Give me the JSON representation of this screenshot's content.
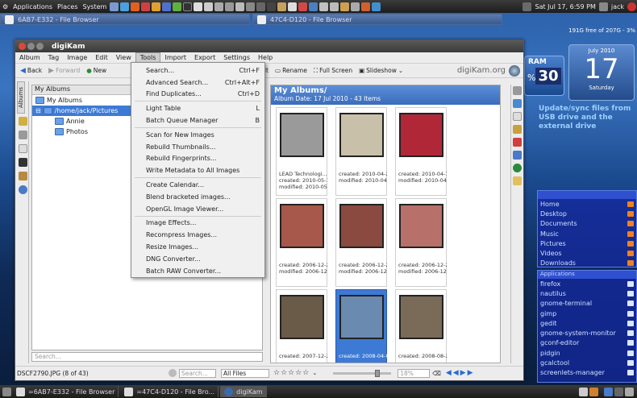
{
  "topbar": {
    "menus": [
      "Applications",
      "Places",
      "System"
    ],
    "datetime": "Sat Jul 17,  6:59 PM",
    "user": "jack"
  },
  "windowlist": [
    "6AB7-E332 - File Browser",
    "47C4-D120 - File Browser"
  ],
  "disk": "191G free of 207G - 3%",
  "widgets": {
    "ram_label": "RAM",
    "ram_percent": "30",
    "ram_symbol": "%",
    "cal_month": "July 2010",
    "cal_day": "17",
    "cal_weekday": "Saturday",
    "note": "Update/sync files from USB drive and the external drive",
    "places": [
      "Home",
      "Desktop",
      "Documents",
      "Music",
      "Pictures",
      "Videos",
      "Downloads"
    ],
    "apps_header": "Applications",
    "apps": [
      "firefox",
      "nautilus",
      "gnome-terminal",
      "gimp",
      "gedit",
      "gnome-system-monitor",
      "gconf-editor",
      "pidgin",
      "gcalctool",
      "screenlets-manager"
    ]
  },
  "app": {
    "title": "digiKam",
    "menus": [
      "Album",
      "Tag",
      "Image",
      "Edit",
      "View",
      "Tools",
      "Import",
      "Export",
      "Settings",
      "Help"
    ],
    "toolbar": {
      "back": "Back",
      "forward": "Forward",
      "new": "New",
      "edit": "Edit",
      "rename": "Rename",
      "fullscreen": "Full Screen",
      "slideshow": "Slideshow",
      "brand": "digiKam.org"
    },
    "sidetab": "Albums",
    "albums": {
      "header": "My Albums",
      "root": "My Albums",
      "path": "/home/jack/Pictures",
      "children": [
        "Annie",
        "Photos"
      ]
    },
    "search_placeholder": "Search...",
    "grid": {
      "title": "My Albums/",
      "subtitle": "Album Date: 17 Jul 2010 - 43 Items",
      "items": [
        {
          "cap1": "LEAD Technologi...",
          "cap2": "created: 2010-05-1...",
          "cap3": "modified: 2010-05-..."
        },
        {
          "cap1": "created: 2010-04-2...",
          "cap2": "modified: 2010-04-...",
          "cap3": ""
        },
        {
          "cap1": "created: 2010-04-1...",
          "cap2": "modified: 2010-04-...",
          "cap3": ""
        },
        {
          "cap1": "created: 2006-12-2...",
          "cap2": "modified: 2006-12-...",
          "cap3": ""
        },
        {
          "cap1": "created: 2006-12-2...",
          "cap2": "modified: 2006-12-...",
          "cap3": ""
        },
        {
          "cap1": "created: 2006-12-2...",
          "cap2": "modified: 2006-12-...",
          "cap3": ""
        },
        {
          "cap1": "created: 2007-12-2...",
          "cap2": "",
          "cap3": ""
        },
        {
          "cap1": "created: 2008-04-0...",
          "cap2": "",
          "cap3": ""
        },
        {
          "cap1": "created: 2008-08-2...",
          "cap2": "",
          "cap3": ""
        }
      ]
    },
    "status": {
      "file": "DSCF2790.JPG (8 of 43)",
      "search_placeholder": "Search...",
      "filter": "All Files",
      "zoom": "18%"
    },
    "tools_menu": [
      {
        "label": "Search...",
        "shortcut": "Ctrl+F"
      },
      {
        "label": "Advanced Search...",
        "shortcut": "Ctrl+Alt+F"
      },
      {
        "label": "Find Duplicates...",
        "shortcut": "Ctrl+D"
      },
      {
        "sep": true
      },
      {
        "label": "Light Table",
        "shortcut": "L"
      },
      {
        "label": "Batch Queue Manager",
        "shortcut": "B"
      },
      {
        "sep": true
      },
      {
        "label": "Scan for New Images",
        "shortcut": ""
      },
      {
        "label": "Rebuild Thumbnails...",
        "shortcut": ""
      },
      {
        "label": "Rebuild Fingerprints...",
        "shortcut": ""
      },
      {
        "label": "Write Metadata to All Images",
        "shortcut": ""
      },
      {
        "sep": true
      },
      {
        "label": "Create Calendar...",
        "shortcut": ""
      },
      {
        "label": "Blend bracketed images...",
        "shortcut": ""
      },
      {
        "label": "OpenGL Image Viewer...",
        "shortcut": ""
      },
      {
        "sep": true
      },
      {
        "label": "Image Effects...",
        "shortcut": ""
      },
      {
        "label": "Recompress Images...",
        "shortcut": ""
      },
      {
        "label": "Resize Images...",
        "shortcut": ""
      },
      {
        "label": "DNG Converter...",
        "shortcut": ""
      },
      {
        "label": "Batch RAW Converter...",
        "shortcut": ""
      }
    ]
  },
  "taskbar": [
    "=6AB7-E332 - File Browser",
    "=47C4-D120 - File Bro...",
    "digiKam"
  ],
  "colors": {
    "accent": "#3d7ad6",
    "panel": "#2a2a2a",
    "places_bg": "#1428a0",
    "folder": "#f08020"
  }
}
